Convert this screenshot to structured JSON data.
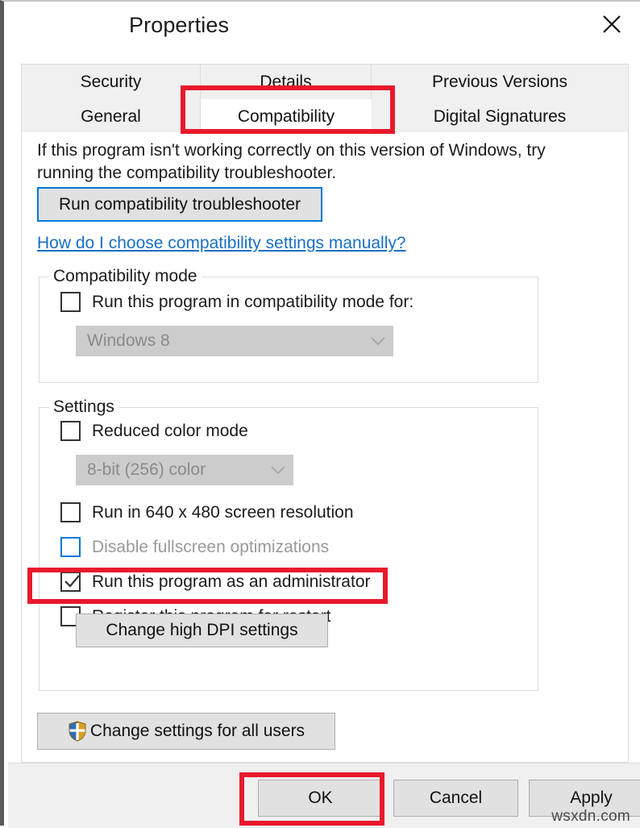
{
  "window": {
    "title": "Properties",
    "close_icon": "close-x-icon"
  },
  "tabs": {
    "row_top": [
      {
        "label": "Security",
        "selected": false
      },
      {
        "label": "Details",
        "selected": false
      },
      {
        "label": "Previous Versions",
        "selected": false
      }
    ],
    "row_bottom": [
      {
        "label": "General",
        "selected": false
      },
      {
        "label": "Compatibility",
        "selected": true
      },
      {
        "label": "Digital Signatures",
        "selected": false
      }
    ]
  },
  "content": {
    "intro_text": "If this program isn't working correctly on this version of Windows, try running the compatibility troubleshooter.",
    "troubleshooter_button": "Run compatibility troubleshooter",
    "help_link": "How do I choose compatibility settings manually?"
  },
  "compatibility_mode": {
    "group_title": "Compatibility mode",
    "checkbox_label": "Run this program in compatibility mode for:",
    "checkbox_checked": false,
    "dropdown_value": "Windows 8",
    "dropdown_enabled": false,
    "chevron_icon": "chevron-down-icon"
  },
  "settings": {
    "group_title": "Settings",
    "reduced_color_label": "Reduced color mode",
    "reduced_color_checked": false,
    "color_depth_value": "8-bit (256) color",
    "color_depth_enabled": false,
    "chevron_icon": "chevron-down-icon",
    "resolution_label": "Run in 640 x 480 screen resolution",
    "resolution_checked": false,
    "fullscreen_label": "Disable fullscreen optimizations",
    "fullscreen_checked": false,
    "admin_label": "Run this program as an administrator",
    "admin_checked": true,
    "restart_label": "Register this program for restart",
    "restart_checked": false,
    "dpi_button": "Change high DPI settings"
  },
  "all_users": {
    "button_label": "Change settings for all users",
    "shield_icon": "uac-shield-icon"
  },
  "dialog_buttons": {
    "ok": "OK",
    "cancel": "Cancel",
    "apply": "Apply"
  },
  "watermark": {
    "text": "wsxdn.com"
  },
  "annotations": {
    "highlight_color": "#e8192c",
    "highlighted_items": [
      "Compatibility",
      "Run this program as an administrator",
      "OK"
    ]
  },
  "colors": {
    "accent_blue": "#0078d7",
    "link_blue": "#1a6fc4",
    "button_face": "#e1e1e1",
    "disabled_combo": "#cccccc",
    "disabled_text": "#8a8a8a"
  }
}
